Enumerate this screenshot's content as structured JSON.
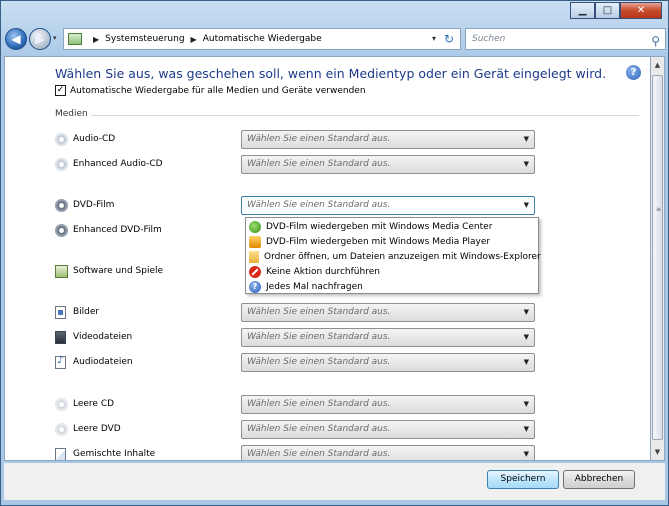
{
  "window": {
    "minimize": "▁",
    "maximize": "□",
    "close": "✕"
  },
  "nav": {
    "back": "◀",
    "forward": "▶",
    "history": "▾",
    "breadcrumb": [
      "Systemsteuerung",
      "Automatische Wiedergabe"
    ],
    "separator": "▶",
    "address_dropdown": "▾",
    "refresh": "↻",
    "search_placeholder": "Suchen"
  },
  "page": {
    "heading": "Wählen Sie aus, was geschehen soll, wenn ein Medientyp oder ein Gerät eingelegt wird.",
    "help": "?",
    "autoplay_checkbox": {
      "label": "Automatische Wiedergabe für alle Medien und Geräte verwenden",
      "checked": true,
      "mark": "✓"
    },
    "section_label": "Medien"
  },
  "media": [
    {
      "label": "Audio-CD",
      "icon": "cd-icon",
      "value": "Wählen Sie einen Standard aus."
    },
    {
      "label": "Enhanced Audio-CD",
      "icon": "cd-icon",
      "value": "Wählen Sie einen Standard aus."
    },
    {
      "label": "DVD-Film",
      "icon": "dvd-icon",
      "value": "Wählen Sie einen Standard aus.",
      "open": true
    },
    {
      "label": "Enhanced DVD-Film",
      "icon": "dvd-icon"
    },
    {
      "label": "Software und Spiele",
      "icon": "software-icon"
    },
    {
      "label": "Bilder",
      "icon": "pictures-icon",
      "value": "Wählen Sie einen Standard aus."
    },
    {
      "label": "Videodateien",
      "icon": "video-icon",
      "value": "Wählen Sie einen Standard aus."
    },
    {
      "label": "Audiodateien",
      "icon": "audio-icon",
      "value": "Wählen Sie einen Standard aus."
    },
    {
      "label": "Leere CD",
      "icon": "blank-cd-icon",
      "value": "Wählen Sie einen Standard aus."
    },
    {
      "label": "Leere DVD",
      "icon": "blank-dvd-icon",
      "value": "Wählen Sie einen Standard aus."
    },
    {
      "label": "Gemischte Inhalte",
      "icon": "mixed-content-icon",
      "value": "Wählen Sie einen Standard aus."
    }
  ],
  "dvd_options": [
    {
      "label": "DVD-Film wiedergeben mit Windows Media Center",
      "icon": "media-center-icon"
    },
    {
      "label": "DVD-Film wiedergeben mit Windows Media Player",
      "icon": "media-player-icon"
    },
    {
      "label": "Ordner öffnen, um Dateien anzuzeigen mit Windows-Explorer",
      "icon": "folder-icon"
    },
    {
      "label": "Keine Aktion durchführen",
      "icon": "no-action-icon"
    },
    {
      "label": "Jedes Mal nachfragen",
      "icon": "ask-icon",
      "glyph": "?"
    }
  ],
  "combo_arrow": "▼",
  "footer": {
    "save": "Speichern",
    "cancel": "Abbrechen"
  }
}
